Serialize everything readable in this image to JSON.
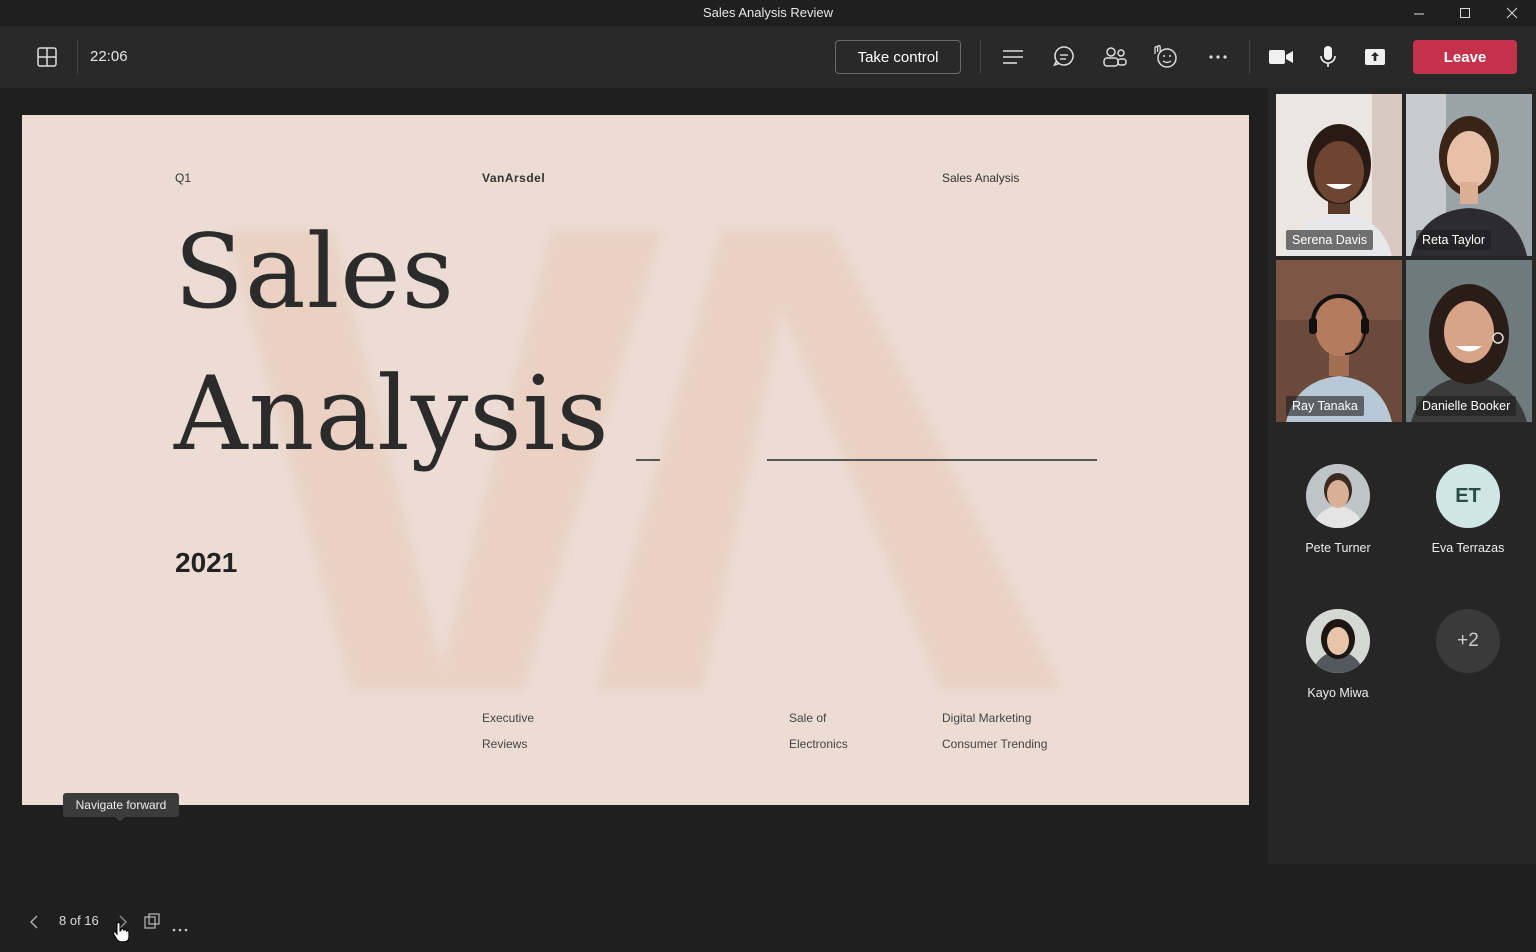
{
  "window": {
    "title": "Sales Analysis Review"
  },
  "toolbar": {
    "time": "22:06",
    "take_control_label": "Take control",
    "leave_label": "Leave"
  },
  "slide": {
    "top_left": "Q1",
    "brand": "VanArsdel",
    "top_right": "Sales Analysis",
    "title_line1": "Sales",
    "title_line2": "Analysis",
    "year": "2021",
    "footer": [
      {
        "line1": "Executive",
        "line2": "Reviews"
      },
      {
        "line1": "Sale of",
        "line2": "Electronics"
      },
      {
        "line1": "Digital Marketing",
        "line2": "Consumer Trending"
      }
    ]
  },
  "slide_nav": {
    "page_indicator": "8 of 16",
    "tooltip": "Navigate forward"
  },
  "participants": {
    "video": [
      {
        "name": "Serena Davis"
      },
      {
        "name": "Reta Taylor"
      },
      {
        "name": "Ray Tanaka"
      },
      {
        "name": "Danielle Booker"
      }
    ],
    "avatars": [
      {
        "name": "Pete Turner"
      },
      {
        "name": "Eva Terrazas",
        "initials": "ET"
      },
      {
        "name": "Kayo Miwa"
      }
    ],
    "overflow": "+2"
  },
  "colors": {
    "leave": "#c4314b",
    "slide_bg": "#ecdcd4",
    "initials_bg": "#cfe7e3"
  }
}
